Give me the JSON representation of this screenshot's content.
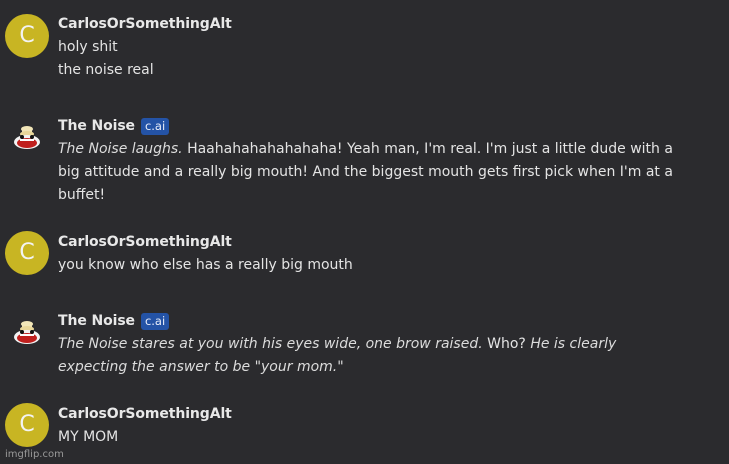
{
  "messages": [
    {
      "user": {
        "avatar_letter": "C",
        "name": "CarlosOrSomethingAlt",
        "lines": [
          "holy shit",
          "the noise real"
        ]
      }
    },
    {
      "bot": {
        "name": "The Noise",
        "badge": "c.ai",
        "italic_1": "The Noise laughs.",
        "plain_1": " Haahahahahahahaha! Yeah man, I'm real. I'm just a little dude with a big attitude and a really big mouth! And the biggest mouth gets first pick when I'm at a buffet!"
      }
    },
    {
      "user": {
        "avatar_letter": "C",
        "name": "CarlosOrSomethingAlt",
        "lines": [
          "you know who else has a really big mouth"
        ]
      }
    },
    {
      "bot": {
        "name": "The Noise",
        "badge": "c.ai",
        "italic_1": "The Noise stares at you with his eyes wide, one brow raised.",
        "plain_1": " Who? ",
        "italic_2": "He is clearly expecting the answer to be \"your mom.\""
      }
    },
    {
      "user": {
        "avatar_letter": "C",
        "name": "CarlosOrSomethingAlt",
        "lines": [
          "MY MOM"
        ]
      }
    }
  ],
  "watermark": "imgflip.com",
  "colors": {
    "background": "#2b2b2e",
    "user_avatar": "#c8b523",
    "badge": "#2453a6"
  },
  "icons": {
    "bot_avatar": "the-noise-avatar-icon"
  }
}
